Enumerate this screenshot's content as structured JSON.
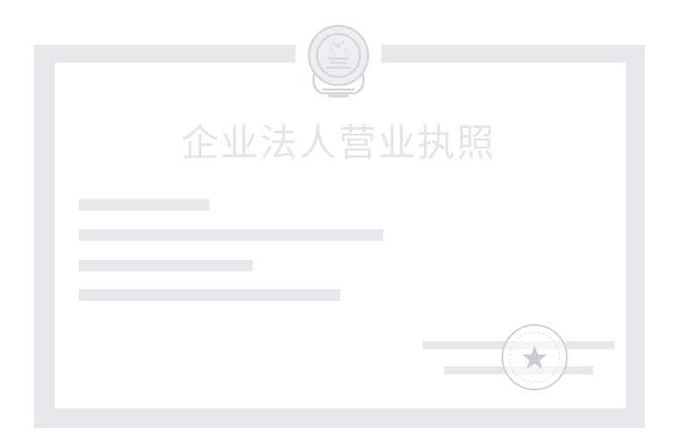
{
  "certificate": {
    "title": "企业法人营业执照",
    "emblem_icon": "national-emblem-icon",
    "seal_icon": "official-seal-star-icon"
  },
  "colors": {
    "frame": "#e6e8ec",
    "placeholder_line": "#e6e8ec",
    "title_text": "#e3e5e9",
    "emblem_outline": "#d4d7dc",
    "emblem_fill": "#e9ebee",
    "background": "#ffffff"
  }
}
